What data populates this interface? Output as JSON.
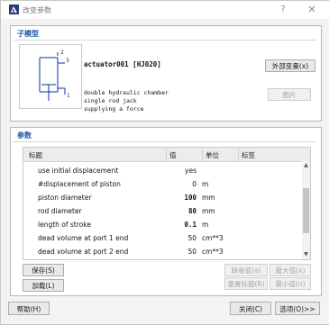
{
  "window": {
    "title": "改变参数",
    "help": "?",
    "close": "✕"
  },
  "submodel": {
    "title": "子模型",
    "name": "actuator001 [HJ020]",
    "description": [
      "double hydraulic chamber",
      "single rod jack",
      "supplying a force"
    ],
    "port_labels": [
      "2",
      "3",
      "1"
    ],
    "external_vars_label": "外部变量(x)",
    "image_label": "图片"
  },
  "parameters": {
    "title": "参数",
    "columns": [
      "标题",
      "值",
      "单位",
      "标签"
    ],
    "rows": [
      {
        "title": "use initial displacement",
        "value": "yes",
        "unit": "",
        "bold": false
      },
      {
        "title": "#displacement of piston",
        "value": "0",
        "unit": "m",
        "bold": false
      },
      {
        "title": "piston diameter",
        "value": "100",
        "unit": "mm",
        "bold": true
      },
      {
        "title": "rod diameter",
        "value": "80",
        "unit": "mm",
        "bold": true
      },
      {
        "title": "length of stroke",
        "value": "0.1",
        "unit": "m",
        "bold": true
      },
      {
        "title": "dead volume at port 1 end",
        "value": "50",
        "unit": "cm**3",
        "bold": false
      },
      {
        "title": "dead volume at port 2 end",
        "value": "50",
        "unit": "cm**3",
        "bold": false
      }
    ],
    "save_label": "保存(S)",
    "load_label": "加载(L)",
    "default_label": "缺省值(a)",
    "max_label": "最大值(x)",
    "reset_title_label": "重置标题(R)",
    "min_label": "最小值(n)"
  },
  "footer": {
    "help_label": "帮助(H)",
    "close_label": "关闭(C)",
    "options_label": "选项(O)>>"
  },
  "colors": {
    "accent": "#1e5aa8",
    "group_border": "#b8b8b8"
  },
  "icons": {
    "app": "app-logo-icon",
    "scroll_up": "▲",
    "scroll_down": "▼"
  }
}
